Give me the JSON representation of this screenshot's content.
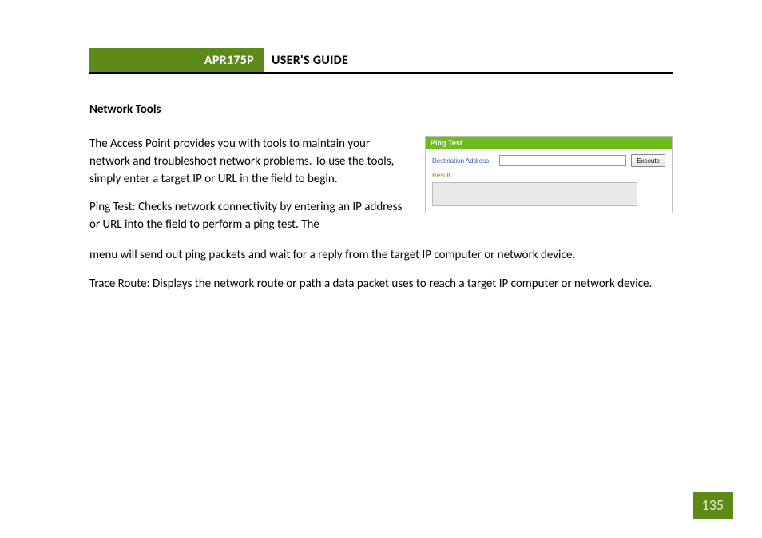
{
  "header": {
    "model": "APR175P",
    "title": "USER'S GUIDE"
  },
  "section_title": "Network Tools",
  "paragraphs": {
    "intro": "The Access Point provides you with tools to maintain your network and troubleshoot network problems. To use the tools, simply enter a target IP or URL in the field to begin.",
    "ping_part1": "Ping Test: Checks network connectivity by entering an IP address or URL into the field to perform a ping test. The",
    "ping_part2": "menu will send out ping packets and wait for a reply from the target IP computer or network device.",
    "trace": "Trace Route: Displays the network route or path a data packet uses to reach a target IP computer or network device."
  },
  "panel": {
    "title": "Ping Test",
    "dest_label": "Destination Address",
    "dest_value": "",
    "execute_label": "Execute",
    "result_label": "Result"
  },
  "page_number": "135"
}
